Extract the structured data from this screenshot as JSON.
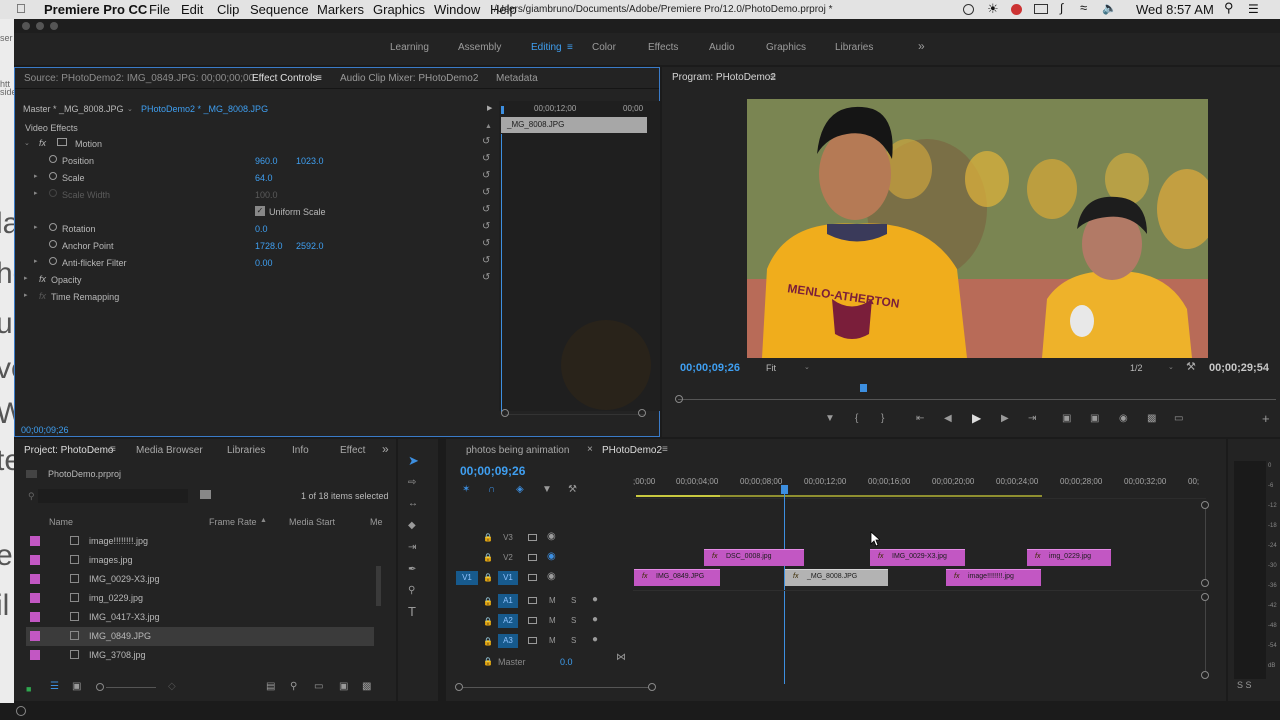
{
  "menubar": {
    "app": "Premiere Pro CC",
    "items": [
      "File",
      "Edit",
      "Clip",
      "Sequence",
      "Markers",
      "Graphics",
      "Window",
      "Help"
    ],
    "path": "/Users/giambruno/Documents/Adobe/Premiere Pro/12.0/PhotoDemo.prproj *",
    "clock": "Wed 8:57 AM"
  },
  "left_strip_glyphs": [
    "la",
    "he",
    "u",
    "ve",
    "W",
    "te",
    "e",
    "il"
  ],
  "left_strip_top": [
    "ser",
    "htt",
    "side"
  ],
  "workspaces": {
    "items": [
      "Learning",
      "Assembly",
      "Editing",
      "Color",
      "Effects",
      "Audio",
      "Graphics",
      "Libraries"
    ],
    "active": "Editing",
    "more": "»"
  },
  "source_tabs": {
    "source": "Source: PHotoDemo2: IMG_0849.JPG: 00;00;00;00",
    "effect_controls": "Effect Controls",
    "audio_mixer": "Audio Clip Mixer: PHotoDemo2",
    "metadata": "Metadata"
  },
  "ec": {
    "master": "Master * _MG_8008.JPG",
    "clip": "PHotoDemo2 * _MG_8008.JPG",
    "t_mid": "00;00;12;00",
    "t_end": "00;00",
    "clip_bar": "_MG_8008.JPG",
    "video_effects": "Video Effects",
    "motion": "Motion",
    "position": "Position",
    "position_x": "960.0",
    "position_y": "1023.0",
    "scale": "Scale",
    "scale_v": "64.0",
    "scale_width": "Scale Width",
    "scale_width_v": "100.0",
    "uniform_scale": "Uniform Scale",
    "rotation": "Rotation",
    "rotation_v": "0.0",
    "anchor": "Anchor Point",
    "anchor_x": "1728.0",
    "anchor_y": "2592.0",
    "antiflicker": "Anti-flicker Filter",
    "antiflicker_v": "0.00",
    "opacity": "Opacity",
    "time_remap": "Time Remapping",
    "timecode": "00;00;09;26"
  },
  "program": {
    "title": "Program: PHotoDemo2",
    "timecode": "00;00;09;26",
    "fit": "Fit",
    "res": "1/2",
    "duration": "00;00;29;54",
    "shirt_text": "MENLO-ATHERTON"
  },
  "project_tabs": {
    "project": "Project: PhotoDemo",
    "media_browser": "Media Browser",
    "libraries": "Libraries",
    "info": "Info",
    "effects": "Effect"
  },
  "project": {
    "file": "PhotoDemo.prproj",
    "selected": "1 of 18 items selected",
    "col_name": "Name",
    "col_fps": "Frame Rate",
    "col_start": "Media Start",
    "col_more": "Me",
    "items": [
      "image!!!!!!!!.jpg",
      "images.jpg",
      "IMG_0029-X3.jpg",
      "img_0229.jpg",
      "IMG_0417-X3.jpg",
      "IMG_0849.JPG",
      "IMG_3708.jpg"
    ]
  },
  "timeline": {
    "tab1": "photos being animation",
    "tab2": "PHotoDemo2",
    "timecode": "00;00;09;26",
    "ruler": [
      ";00;00",
      "00;00;04;00",
      "00;00;08;00",
      "00;00;12;00",
      "00;00;16;00",
      "00;00;20;00",
      "00;00;24;00",
      "00;00;28;00",
      "00;00;32;00",
      "00;"
    ],
    "tracks_v": [
      "V3",
      "V2",
      "V1"
    ],
    "tracks_a": [
      "A1",
      "A2",
      "A3"
    ],
    "src_v1": "V1",
    "master": "Master",
    "master_v": "0.0",
    "clips_v2": [
      {
        "name": "DSC_0008.jpg"
      },
      {
        "name": "IMG_0029-X3.jpg"
      },
      {
        "name": "img_0229.jpg"
      }
    ],
    "clips_v1": [
      {
        "name": "IMG_0849.JPG"
      },
      {
        "name": "_MG_8008.JPG"
      },
      {
        "name": "image!!!!!!!!.jpg"
      }
    ]
  },
  "meter": {
    "scale": [
      "0",
      "-6",
      "-12",
      "-18",
      "-24",
      "-30",
      "-36",
      "-42",
      "-48",
      "-54",
      "dB"
    ],
    "solo": "S  S"
  }
}
